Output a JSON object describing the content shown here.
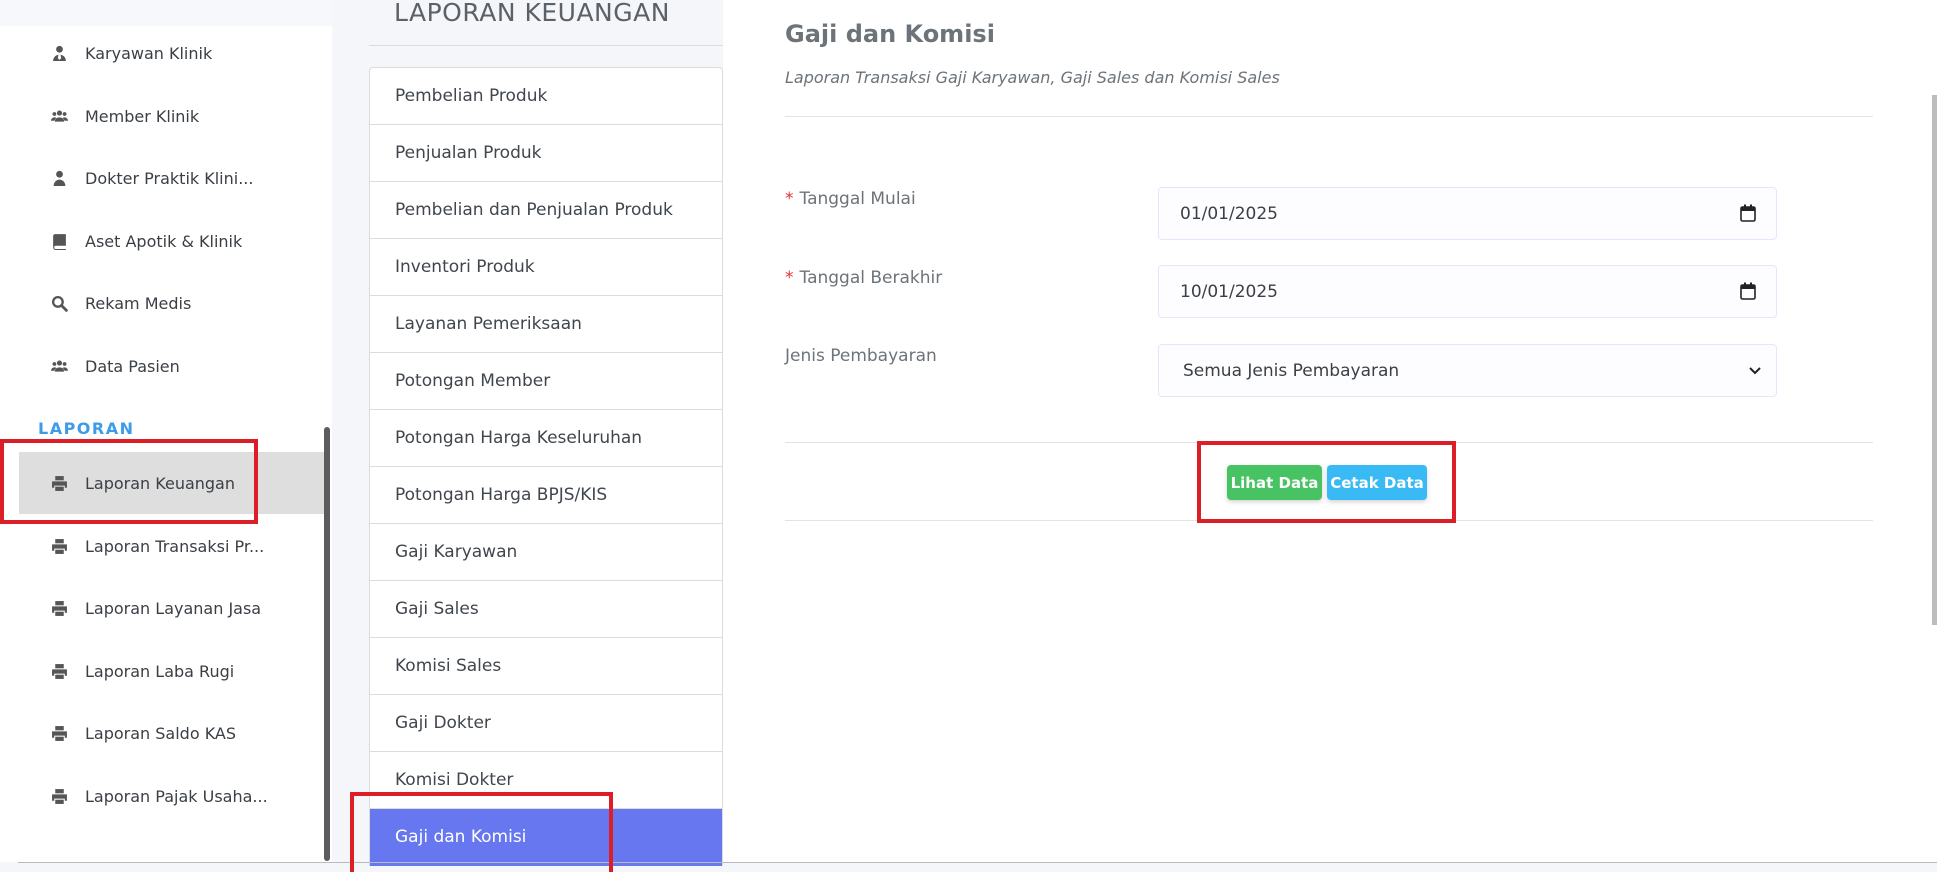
{
  "sidebar": {
    "items": [
      {
        "label": "Karyawan Klinik",
        "icon": "user-tie-icon"
      },
      {
        "label": "Member Klinik",
        "icon": "users-icon"
      },
      {
        "label": "Dokter Praktik Klini...",
        "icon": "user-icon"
      },
      {
        "label": "Aset Apotik & Klinik",
        "icon": "book-icon"
      },
      {
        "label": "Rekam Medis",
        "icon": "search-icon"
      },
      {
        "label": "Data Pasien",
        "icon": "users-icon"
      }
    ],
    "section_label": "LAPORAN",
    "report_items": [
      {
        "label": "Laporan Keuangan",
        "icon": "print-icon",
        "active": true
      },
      {
        "label": "Laporan Transaksi Pr...",
        "icon": "print-icon"
      },
      {
        "label": "Laporan Layanan Jasa",
        "icon": "print-icon"
      },
      {
        "label": "Laporan Laba Rugi",
        "icon": "print-icon"
      },
      {
        "label": "Laporan Saldo KAS",
        "icon": "print-icon"
      },
      {
        "label": "Laporan Pajak Usaha...",
        "icon": "print-icon"
      }
    ]
  },
  "report_menu": {
    "title": "LAPORAN KEUANGAN",
    "items": [
      "Pembelian Produk",
      "Penjualan Produk",
      "Pembelian dan Penjualan Produk",
      "Inventori Produk",
      "Layanan Pemeriksaan",
      "Potongan Member",
      "Potongan Harga Keseluruhan",
      "Potongan Harga BPJS/KIS",
      "Gaji Karyawan",
      "Gaji Sales",
      "Komisi Sales",
      "Gaji Dokter",
      "Komisi Dokter",
      "Gaji dan Komisi"
    ],
    "active_item": "Gaji dan Komisi"
  },
  "content": {
    "title": "Gaji dan Komisi",
    "subtitle": "Laporan Transaksi Gaji Karyawan, Gaji Sales dan Komisi Sales",
    "required_mark": "*",
    "fields": {
      "start_date_label": "Tanggal Mulai",
      "start_date_value": "01/01/2025",
      "end_date_label": "Tanggal Berakhir",
      "end_date_value": "10/01/2025",
      "payment_type_label": "Jenis Pembayaran",
      "payment_type_value": "Semua Jenis Pembayaran"
    },
    "buttons": {
      "view_label": "Lihat Data",
      "print_label": "Cetak Data"
    }
  },
  "colors": {
    "accent": "#6777ef",
    "section": "#3d9be9",
    "success": "#47c363",
    "info": "#3abaf4",
    "highlight": "#dc1f26"
  }
}
